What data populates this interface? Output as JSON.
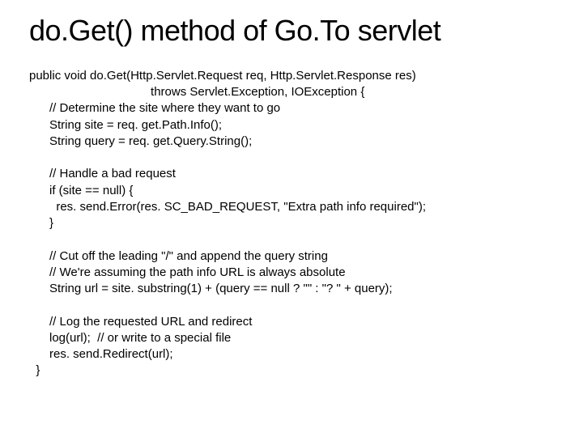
{
  "title": "do.Get() method of Go.To servlet",
  "lines": {
    "l0": "public void do.Get(Http.Servlet.Request req, Http.Servlet.Response res)",
    "l1": "                                    throws Servlet.Exception, IOException {",
    "l2": "      // Determine the site where they want to go",
    "l3": "      String site = req. get.Path.Info();",
    "l4": "      String query = req. get.Query.String();",
    "l5": "",
    "l6": "      // Handle a bad request",
    "l7": "      if (site == null) {",
    "l8": "        res. send.Error(res. SC_BAD_REQUEST, \"Extra path info required\");",
    "l9": "      }",
    "l10": "",
    "l11": "      // Cut off the leading \"/\" and append the query string",
    "l12": "      // We're assuming the path info URL is always absolute",
    "l13": "      String url = site. substring(1) + (query == null ? \"\" : \"? \" + query);",
    "l14": "",
    "l15": "      // Log the requested URL and redirect",
    "l16": "      log(url);  // or write to a special file",
    "l17": "      res. send.Redirect(url);",
    "l18": "  }"
  }
}
